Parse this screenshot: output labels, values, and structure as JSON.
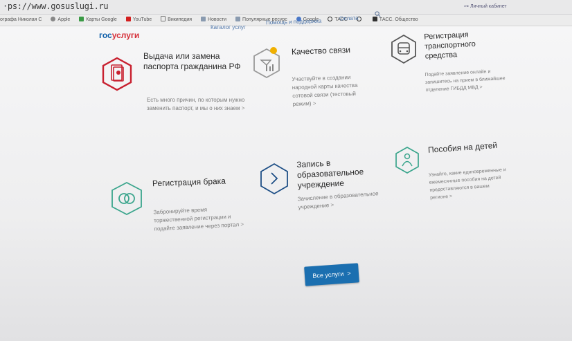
{
  "browser": {
    "url": "·ps://www.gosuslugi.ru",
    "bookmarks": [
      {
        "label": "ографа Николая С",
        "color": "#b0b0b0"
      },
      {
        "label": "Apple",
        "color": "#888888"
      },
      {
        "label": "Карты Google",
        "color": "#3a9a45"
      },
      {
        "label": "YouTube",
        "color": "#d31f1f"
      },
      {
        "label": "Википедия",
        "color": "#777777"
      },
      {
        "label": "Новости",
        "color": "#8a9bb0"
      },
      {
        "label": "Популярные ресурс",
        "color": "#8a9bb0"
      },
      {
        "label": "Google",
        "color": "#4a78c8"
      },
      {
        "label": "ТАСС",
        "color": "#333333"
      },
      {
        "label": "",
        "color": "#333333"
      },
      {
        "label": "ТАСС. Общество",
        "color": "#333333"
      }
    ]
  },
  "header": {
    "logo_a": "гос",
    "logo_b": "услуги",
    "nav": [
      "Каталог услуг",
      "Помощь и поддержка",
      "Оплата"
    ],
    "cabinet": "Личный кабинет"
  },
  "services": [
    {
      "title": "Выдача или замена паспорта гражданина РФ",
      "desc": "Есть много причин, по которым нужно заменить паспорт, и мы о них знаем",
      "icon": "passport-icon"
    },
    {
      "title": "Качество связи",
      "desc": "Участвуйте в создании народной карты качества сотовой связи (тестовый режим)",
      "icon": "signal-icon"
    },
    {
      "title": "Регистрация транспортного средства",
      "desc": "Подайте заявление онлайн и запишитесь на прием в ближайшее отделение ГИБДД МВД",
      "icon": "bus-icon"
    },
    {
      "title": "Регистрация брака",
      "desc": "Забронируйте время торжественной регистрации и подайте заявление через портал",
      "icon": "rings-icon"
    },
    {
      "title": "Запись в образовательное учреждение",
      "desc": "Зачисление в образовательное учреждение",
      "icon": "chevron-right-icon"
    },
    {
      "title": "Пособия на детей",
      "desc": "Узнайте, какие единовременные и ежемесячные пособия на детей предоставляются в вашем регионе",
      "icon": "child-icon"
    }
  ],
  "all_services_label": "Все услуги",
  "arrow": ">",
  "colors": {
    "brand_blue": "#0b5da8",
    "brand_red": "#d52f38",
    "button": "#1b6fb0",
    "green": "#3aa58c"
  }
}
